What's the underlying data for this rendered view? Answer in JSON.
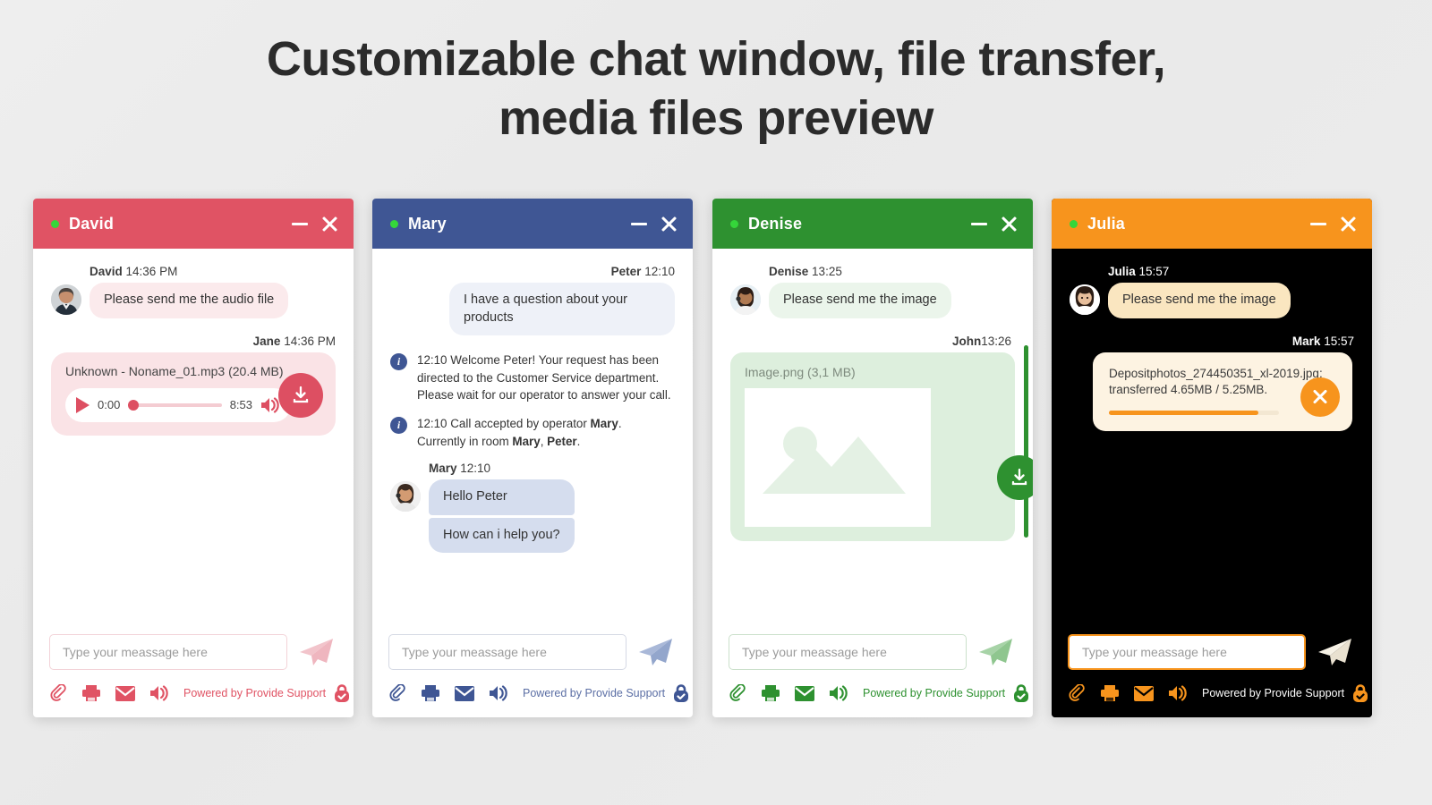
{
  "heading": {
    "line1": "Customizable chat window, file transfer,",
    "line2": "media files preview"
  },
  "common": {
    "input_placeholder": "Type your meassage here",
    "powered_label": "Powered by Provide Support",
    "icons": {
      "attach": "paperclip-icon",
      "print": "printer-icon",
      "email": "envelope-icon",
      "sound": "speaker-icon",
      "send": "send-plane-icon",
      "minimize": "minimize-icon",
      "close": "close-icon",
      "lock": "lock-badge-icon",
      "download": "download-icon",
      "play": "play-icon",
      "info": "info-icon",
      "status": "online-status-dot"
    }
  },
  "windows": [
    {
      "id": "david",
      "title": "David",
      "accent": "#E05364",
      "header_bg": "#E05364",
      "body_bg": "#ffffff",
      "bubble_bg": "#FBEAEC",
      "card_bg": "#FAE3E6",
      "input_border": "#F3D3D8",
      "input_bg": "#ffffff",
      "powered_color": "#E05364",
      "tool_color": "#E05364",
      "send_color": "#F2C4CB",
      "messages": [
        {
          "kind": "text",
          "who": "David",
          "time": "14:36 PM",
          "side": "left",
          "avatar": "man",
          "text": "Please send me the audio file"
        },
        {
          "kind": "audio",
          "who": "Jane",
          "time": "14:36 PM",
          "side": "right",
          "file_name": "Unknown - Noname_01.mp3 (20.4 MB)",
          "current_time": "0:00",
          "total_time": "8:53",
          "progress_pct": 0
        }
      ]
    },
    {
      "id": "mary",
      "title": "Mary",
      "accent": "#3F5694",
      "header_bg": "#3F5694",
      "body_bg": "#ffffff",
      "bubble_bg": "#EEF1F8",
      "bubble_bg_alt": "#D5DDEE",
      "input_border": "#D5D9E4",
      "input_bg": "#ffffff",
      "powered_color": "#5C6FA5",
      "tool_color": "#3F5694",
      "send_color": "#A9B8D8",
      "messages": [
        {
          "kind": "text",
          "who": "Peter",
          "time": "12:10",
          "side": "right",
          "text": "I have a question about your products"
        },
        {
          "kind": "system",
          "text_parts": [
            {
              "t": "12:10 Welcome Peter! Your request has been directed to the Customer Service department. Please wait for our operator to answer your call.",
              "b": false
            }
          ]
        },
        {
          "kind": "system",
          "text_parts": [
            {
              "t": "12:10 Call accepted by operator ",
              "b": false
            },
            {
              "t": "Mary",
              "b": true
            },
            {
              "t": ". Currently in room ",
              "b": false
            },
            {
              "t": "Mary",
              "b": true
            },
            {
              "t": ", ",
              "b": false
            },
            {
              "t": "Peter",
              "b": true
            },
            {
              "t": ".",
              "b": false
            }
          ]
        },
        {
          "kind": "group",
          "who": "Mary",
          "time": "12:10",
          "side": "left",
          "avatar": "woman_headset",
          "texts": [
            "Hello Peter",
            "How can i help you?"
          ]
        }
      ]
    },
    {
      "id": "denise",
      "title": "Denise",
      "accent": "#2E9130",
      "header_bg": "#2E9130",
      "body_bg": "#ffffff",
      "bubble_bg": "#EBF5EB",
      "card_bg": "#DDEFDD",
      "input_border": "#CBE0CB",
      "input_bg": "#ffffff",
      "powered_color": "#2E9130",
      "tool_color": "#2E9130",
      "send_color": "#A7D3A7",
      "scrollbar_color": "#2E9130",
      "messages": [
        {
          "kind": "text",
          "who": "Denise",
          "time": "13:25",
          "side": "left",
          "avatar": "woman_headset",
          "text": "Please send me the image"
        },
        {
          "kind": "image",
          "who": "John",
          "time": "13:26",
          "side": "right",
          "file_name": "Image.png (3,1 MB)"
        }
      ]
    },
    {
      "id": "julia",
      "title": "Julia",
      "accent": "#F7941D",
      "header_bg": "#F7941D",
      "body_bg": "#000000",
      "bubble_bg": "#FAE6C0",
      "card_bg": "#FDF3E2",
      "input_border": "#F7941D",
      "input_bg": "#ffffff",
      "powered_color": "#ffffff",
      "tool_color": "#F7941D",
      "send_color": "#F5EFE2",
      "meta_color": "#ffffff",
      "messages": [
        {
          "kind": "text",
          "who": "Julia",
          "time": "15:57",
          "side": "left",
          "avatar": "woman_asian",
          "text": "Please send me the image"
        },
        {
          "kind": "transfer",
          "who": "Mark",
          "time": "15:57",
          "side": "right",
          "text_line1": "Depositphotos_274450351_xl-2019.jpg:",
          "text_line2": "transferred 4.65MB / 5.25MB.",
          "progress_pct": 88
        }
      ]
    }
  ]
}
